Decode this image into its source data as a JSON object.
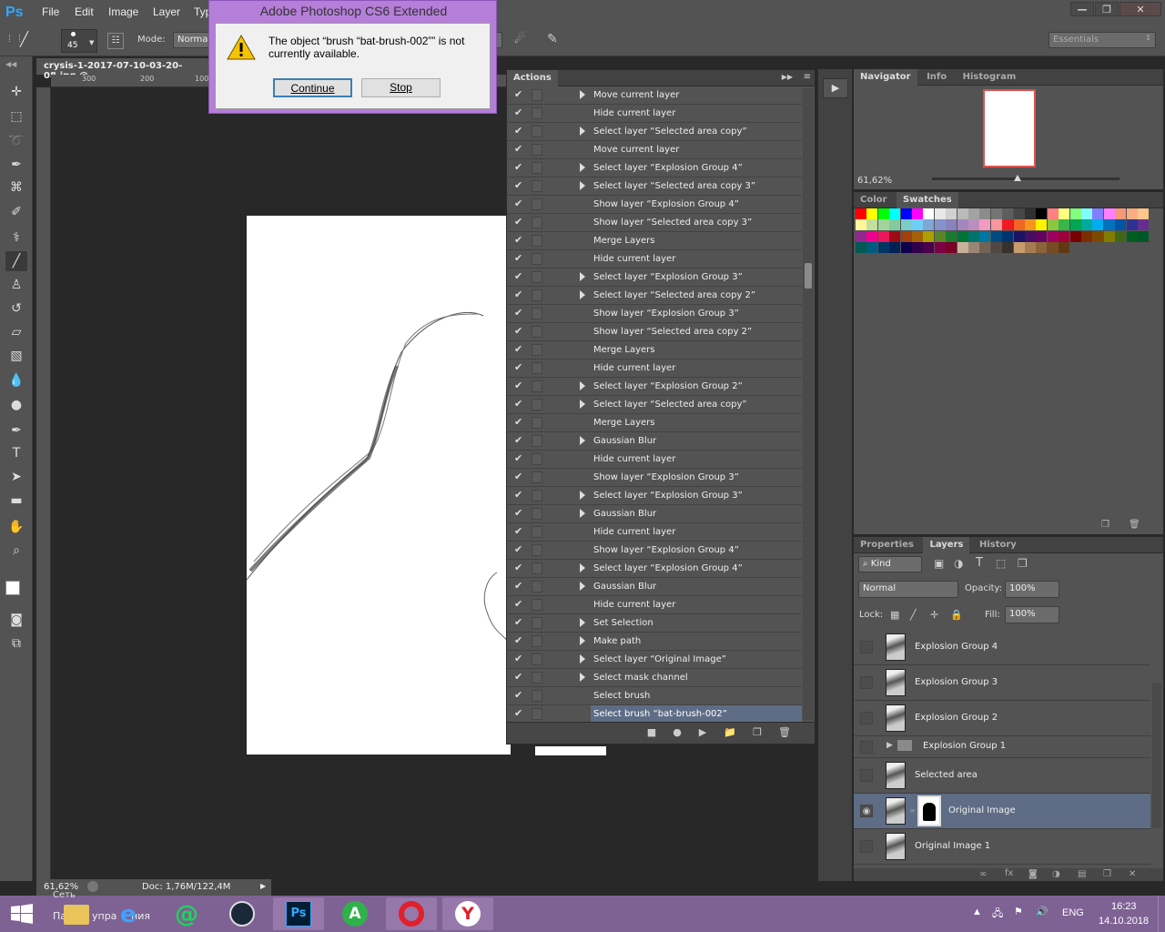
{
  "app": {
    "logo": "Ps",
    "title": "Adobe Photoshop CS6 Extended"
  },
  "menu": [
    "File",
    "Edit",
    "Image",
    "Layer",
    "Typ"
  ],
  "window_controls": {
    "minimize": "—",
    "restore": "❐",
    "close": "✕"
  },
  "options": {
    "brush_size": "45",
    "mode_label": "Mode:",
    "mode_value": "Normal",
    "workspace": "Essentials"
  },
  "document": {
    "tab_title": "crysis-1-2017-07-10-03-20-08.jpg @",
    "ruler_ticks": [
      "300",
      "200",
      "100"
    ],
    "zoom": "61,62%",
    "doc_info": "Doc: 1,76M/122,4M"
  },
  "dialog": {
    "title": "Adobe Photoshop CS6 Extended",
    "message_line1": "The object “brush “bat-brush-002”” is not",
    "message_line2": "currently available.",
    "continue_label": "Continue",
    "stop_label": "Stop"
  },
  "actions": {
    "tab": "Actions",
    "rows": [
      {
        "name": "Move current layer",
        "expand": true
      },
      {
        "name": "Hide current layer",
        "expand": false
      },
      {
        "name": "Select layer “Selected area copy”",
        "expand": true
      },
      {
        "name": "Move current layer",
        "expand": false
      },
      {
        "name": "Select layer “Explosion Group 4”",
        "expand": true
      },
      {
        "name": "Select layer “Selected area copy 3”",
        "expand": true
      },
      {
        "name": "Show layer “Explosion Group 4”",
        "expand": false
      },
      {
        "name": "Show layer “Selected area copy 3”",
        "expand": false
      },
      {
        "name": "Merge Layers",
        "expand": false
      },
      {
        "name": "Hide current layer",
        "expand": false
      },
      {
        "name": "Select layer “Explosion Group 3”",
        "expand": true
      },
      {
        "name": "Select layer “Selected area copy 2”",
        "expand": true
      },
      {
        "name": "Show layer “Explosion Group 3”",
        "expand": false
      },
      {
        "name": "Show layer “Selected area copy 2”",
        "expand": false
      },
      {
        "name": "Merge Layers",
        "expand": false
      },
      {
        "name": "Hide current layer",
        "expand": false
      },
      {
        "name": "Select layer “Explosion Group 2”",
        "expand": true
      },
      {
        "name": "Select layer “Selected area copy”",
        "expand": true
      },
      {
        "name": "Merge Layers",
        "expand": false
      },
      {
        "name": "Gaussian Blur",
        "expand": true
      },
      {
        "name": "Hide current layer",
        "expand": false
      },
      {
        "name": "Show layer “Explosion Group 3”",
        "expand": false
      },
      {
        "name": "Select layer “Explosion Group 3”",
        "expand": true
      },
      {
        "name": "Gaussian Blur",
        "expand": true
      },
      {
        "name": "Hide current layer",
        "expand": false
      },
      {
        "name": "Show layer “Explosion Group 4”",
        "expand": false
      },
      {
        "name": "Select layer “Explosion Group 4”",
        "expand": true
      },
      {
        "name": "Gaussian Blur",
        "expand": true
      },
      {
        "name": "Hide current layer",
        "expand": false
      },
      {
        "name": "Set Selection",
        "expand": true
      },
      {
        "name": "Make path",
        "expand": true
      },
      {
        "name": "Select layer “Original Image”",
        "expand": true
      },
      {
        "name": "Select mask channel",
        "expand": true
      },
      {
        "name": "Select brush",
        "expand": false
      },
      {
        "name": "Select brush “bat-brush-002”",
        "expand": false,
        "selected": true
      }
    ]
  },
  "navigator": {
    "tabs": [
      "Navigator",
      "Info",
      "Histogram"
    ],
    "zoom": "61,62%"
  },
  "swatches": {
    "tabs": [
      "Color",
      "Swatches"
    ]
  },
  "layers": {
    "tabs": [
      "Properties",
      "Layers",
      "History"
    ],
    "filter": "Kind",
    "blend": "Normal",
    "opacity_label": "Opacity:",
    "opacity": "100%",
    "lock_label": "Lock:",
    "fill_label": "Fill:",
    "fill": "100%",
    "rows": [
      {
        "name": "Explosion Group 4",
        "visible": false
      },
      {
        "name": "Explosion Group 3",
        "visible": false
      },
      {
        "name": "Explosion Group 2",
        "visible": false
      },
      {
        "name": "Explosion Group 1",
        "visible": false,
        "group": true
      },
      {
        "name": "Selected area",
        "visible": false
      },
      {
        "name": "Original Image",
        "visible": true,
        "selected": true,
        "mask": true
      },
      {
        "name": "Original Image 1",
        "visible": false
      }
    ]
  },
  "taskbar": {
    "overlay_text1": "Сеть",
    "overlay_text2": "Па",
    "overlay_text3": "упра",
    "overlay_text4": "ния",
    "lang": "ENG",
    "time": "16:23",
    "date": "14.10.2018"
  },
  "colors": {
    "accent": "#31a8ff",
    "selected": "#5e6d85",
    "dialog": "#b57ed9"
  }
}
